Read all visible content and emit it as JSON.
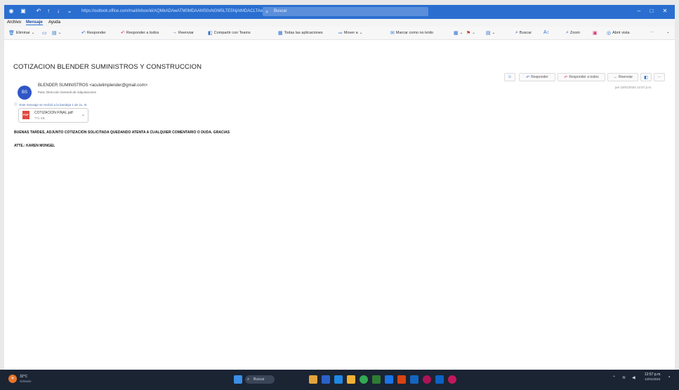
{
  "titlebar": {
    "path": "https://outlook.office.com/mail/inbox/id/AQMkADAwATM0MDAAMS0xNGM5LTE5NjAtMDACLTAwCgBGAAADrP",
    "search_placeholder": "Buscar"
  },
  "menubar": {
    "items": [
      "Archivo",
      "Mensaje",
      "Ayuda"
    ],
    "active": "Mensaje"
  },
  "ribbon": {
    "eliminar": "Eliminar",
    "responder": "Responder",
    "responder_todos": "Responder a todos",
    "reenviar": "Reenviar",
    "compartir_teams": "Compartir con Teams",
    "todas_apps": "Todas las aplicaciones",
    "mover": "Mover a",
    "marcar_no_leido": "Marcar como no leído",
    "buscar": "Buscar",
    "zoom": "Zoom",
    "vista": "Abrir vista",
    "more": "···"
  },
  "message": {
    "subject": "COTIZACION BLENDER SUMINISTROS Y CONSTRUCCION",
    "sender": "BLENDER SUMINISTROS <acutelimplender@gmail.com>",
    "recipient": "Para: Dirección General de Adquisiciones",
    "avatar_initials": "BS",
    "info_line": "Este mensaje se recibió a la bandeja 1 de Ju. III.",
    "attachment_name": "COTIZACION FINAL.pdf",
    "attachment_size": "771 KB",
    "body_line1": "BUENAS TARDES, ADJUNTO COTIZACIÓN SOLICITADA QUEDANDO ATENTA A CUALQUIER COMENTARIO O DUDA. GRACIAS",
    "body_line2": "ATTE.: KAREN MONGEL",
    "date": "jue 12/01/2024 12:57 p.m."
  },
  "actions": {
    "responder": "Responder",
    "responder_todos": "Responder a todos",
    "reenviar": "Reenviar",
    "more": "···"
  },
  "taskbar": {
    "weather_temp": "32°C",
    "weather_desc": "Soleado",
    "search_label": "Buscar",
    "clock_time": "12:57 p.m.",
    "clock_date": "12/01/2024"
  }
}
